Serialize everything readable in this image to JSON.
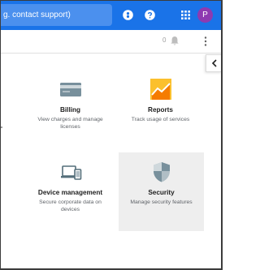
{
  "header": {
    "search_text": "g. contact support)",
    "avatar_letter": "P"
  },
  "subbar": {
    "notification_count": "0"
  },
  "cards": [
    {
      "title": "Billing",
      "description": "View charges and manage licenses",
      "icon": "credit-card-icon"
    },
    {
      "title": "Reports",
      "description": "Track usage of services",
      "icon": "reports-chart-icon"
    },
    {
      "title": "Device management",
      "description": "Secure corporate data on devices",
      "icon": "devices-icon"
    },
    {
      "title": "Security",
      "description": "Manage security features",
      "icon": "shield-icon"
    }
  ],
  "colors": {
    "appbar": "#1a73e8",
    "search_bg": "#4b90ee",
    "avatar": "#8e3ab1",
    "hover_card": "#eeeeee"
  }
}
